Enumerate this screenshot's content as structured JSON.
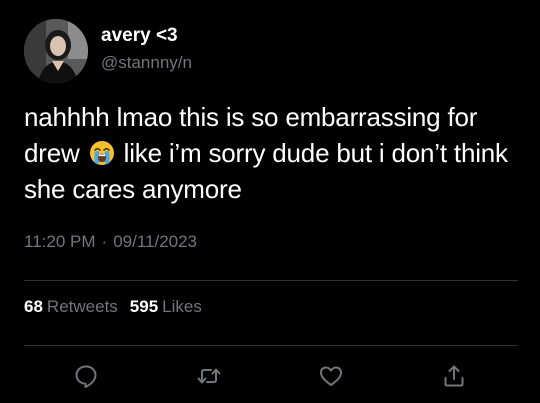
{
  "user": {
    "display_name": "avery <3",
    "handle": "@stannny/n"
  },
  "tweet": {
    "text_before_emoji": "nahhhh lmao this is so embarrassing for drew ",
    "emoji": "loudly-crying-face",
    "text_after_emoji": " like i’m sorry dude but i don’t think she cares anymore"
  },
  "meta": {
    "time": "11:20 PM",
    "separator": "·",
    "date": "09/11/2023"
  },
  "stats": {
    "retweets_count": "68",
    "retweets_label": "Retweets",
    "likes_count": "595",
    "likes_label": "Likes"
  },
  "actions": {
    "reply_icon": "reply-icon",
    "retweet_icon": "retweet-icon",
    "like_icon": "heart-icon",
    "share_icon": "share-icon"
  },
  "colors": {
    "background": "#000000",
    "text": "#ffffff",
    "muted": "#71767b",
    "divider": "#2f3336"
  }
}
